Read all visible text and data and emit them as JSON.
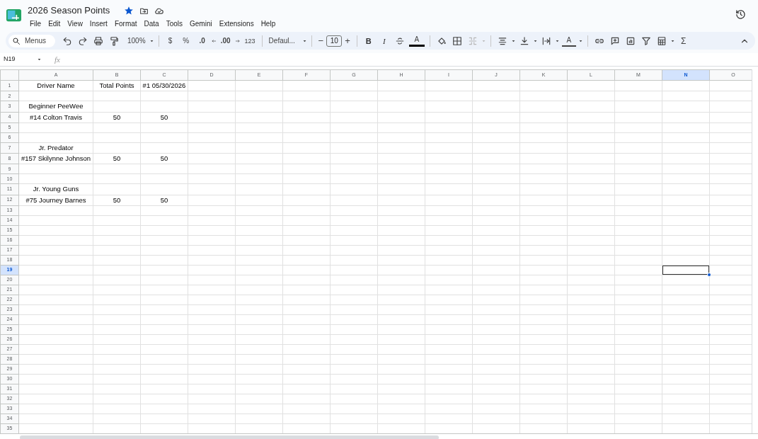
{
  "document": {
    "title": "2026 Season Points",
    "starred": true
  },
  "menu": [
    "File",
    "Edit",
    "View",
    "Insert",
    "Format",
    "Data",
    "Tools",
    "Gemini",
    "Extensions",
    "Help"
  ],
  "toolbar": {
    "search_label": "Menus",
    "zoom": "100%",
    "currency": "$",
    "percent": "%",
    "decrease_decimals": ".0",
    "increase_decimals": ".00",
    "number_format": "123",
    "font": "Defaul...",
    "font_size_minus": "−",
    "font_size": "10",
    "font_size_plus": "+",
    "bold": "B",
    "italic": "I",
    "text_color": "A",
    "merge_disabled": true,
    "text_rotation": "A",
    "sum": "Σ"
  },
  "formula_bar": {
    "cell_ref": "N19",
    "fx": "fx"
  },
  "sheet": {
    "columns": [
      {
        "label": "A",
        "selected": false
      },
      {
        "label": "B",
        "selected": false
      },
      {
        "label": "C",
        "selected": false
      },
      {
        "label": "D",
        "selected": false
      },
      {
        "label": "E",
        "selected": false
      },
      {
        "label": "F",
        "selected": false
      },
      {
        "label": "G",
        "selected": false
      },
      {
        "label": "H",
        "selected": false
      },
      {
        "label": "I",
        "selected": false
      },
      {
        "label": "J",
        "selected": false
      },
      {
        "label": "K",
        "selected": false
      },
      {
        "label": "L",
        "selected": false
      },
      {
        "label": "M",
        "selected": false
      },
      {
        "label": "N",
        "selected": true
      },
      {
        "label": "O",
        "selected": false
      }
    ],
    "rows": [
      {
        "label": "1",
        "selected": false,
        "cells": [
          "Driver Name",
          "Total Points",
          "#1 05/30/2026"
        ]
      },
      {
        "label": "2",
        "selected": false
      },
      {
        "label": "3",
        "selected": false,
        "cells": [
          "Beginner PeeWee"
        ]
      },
      {
        "label": "4",
        "selected": false,
        "cells": [
          "#14 Colton Travis",
          "50",
          "50"
        ]
      },
      {
        "label": "5",
        "selected": false
      },
      {
        "label": "6",
        "selected": false
      },
      {
        "label": "7",
        "selected": false,
        "cells": [
          "Jr. Predator"
        ]
      },
      {
        "label": "8",
        "selected": false,
        "cells": [
          "#157 Skilynne Johnson",
          "50",
          "50"
        ]
      },
      {
        "label": "9",
        "selected": false
      },
      {
        "label": "10",
        "selected": false
      },
      {
        "label": "11",
        "selected": false,
        "cells": [
          "Jr. Young Guns"
        ]
      },
      {
        "label": "12",
        "selected": false,
        "cells": [
          "#75 Journey Barnes",
          "50",
          "50"
        ]
      },
      {
        "label": "13",
        "selected": false
      },
      {
        "label": "14",
        "selected": false
      },
      {
        "label": "15",
        "selected": false
      },
      {
        "label": "16",
        "selected": false
      },
      {
        "label": "17",
        "selected": false
      },
      {
        "label": "18",
        "selected": false
      },
      {
        "label": "19",
        "selected": true
      },
      {
        "label": "20",
        "selected": false
      },
      {
        "label": "21",
        "selected": false
      },
      {
        "label": "22",
        "selected": false
      },
      {
        "label": "23",
        "selected": false
      },
      {
        "label": "24",
        "selected": false
      },
      {
        "label": "25",
        "selected": false
      },
      {
        "label": "26",
        "selected": false
      },
      {
        "label": "27",
        "selected": false
      },
      {
        "label": "28",
        "selected": false
      },
      {
        "label": "29",
        "selected": false
      },
      {
        "label": "30",
        "selected": false
      },
      {
        "label": "31",
        "selected": false
      },
      {
        "label": "32",
        "selected": false
      },
      {
        "label": "33",
        "selected": false
      },
      {
        "label": "34",
        "selected": false
      },
      {
        "label": "35",
        "selected": false
      }
    ]
  }
}
